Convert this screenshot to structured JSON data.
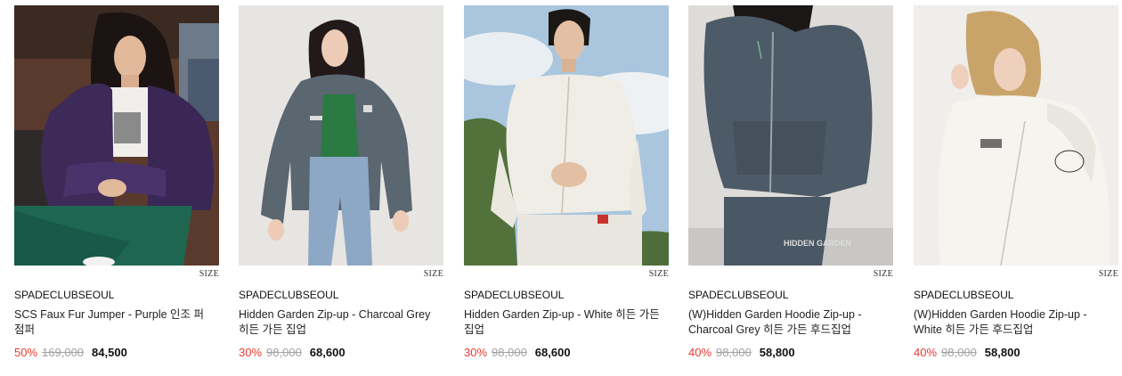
{
  "products": [
    {
      "size_label": "SIZE",
      "brand": "SPADECLUBSEOUL",
      "name": "SCS Faux Fur Jumper - Purple 인조 퍼 점퍼",
      "discount": "50%",
      "original_price": "169,000",
      "sale_price": "84,500",
      "photo": "woman-purple-fur-jumper"
    },
    {
      "size_label": "SIZE",
      "brand": "SPADECLUBSEOUL",
      "name": "Hidden Garden Zip-up - Charcoal Grey 히든 가든 집업",
      "discount": "30%",
      "original_price": "98,000",
      "sale_price": "68,600",
      "photo": "woman-charcoal-zip-up"
    },
    {
      "size_label": "SIZE",
      "brand": "SPADECLUBSEOUL",
      "name": "Hidden Garden Zip-up - White 히든 가든 집업",
      "discount": "30%",
      "original_price": "98,000",
      "sale_price": "68,600",
      "photo": "man-white-zip-up-sky"
    },
    {
      "size_label": "SIZE",
      "brand": "SPADECLUBSEOUL",
      "name": "(W)Hidden Garden Hoodie Zip-up - Charcoal Grey 히든 가든 후드집업",
      "discount": "40%",
      "original_price": "98,000",
      "sale_price": "58,800",
      "photo": "charcoal-hoodie-zip-up",
      "print_text": "HIDDEN GARDEN"
    },
    {
      "size_label": "SIZE",
      "brand": "SPADECLUBSEOUL",
      "name": "(W)Hidden Garden Hoodie Zip-up - White 히든 가든 후드집업",
      "discount": "40%",
      "original_price": "98,000",
      "sale_price": "58,800",
      "photo": "woman-white-hoodie-zip-up"
    }
  ]
}
